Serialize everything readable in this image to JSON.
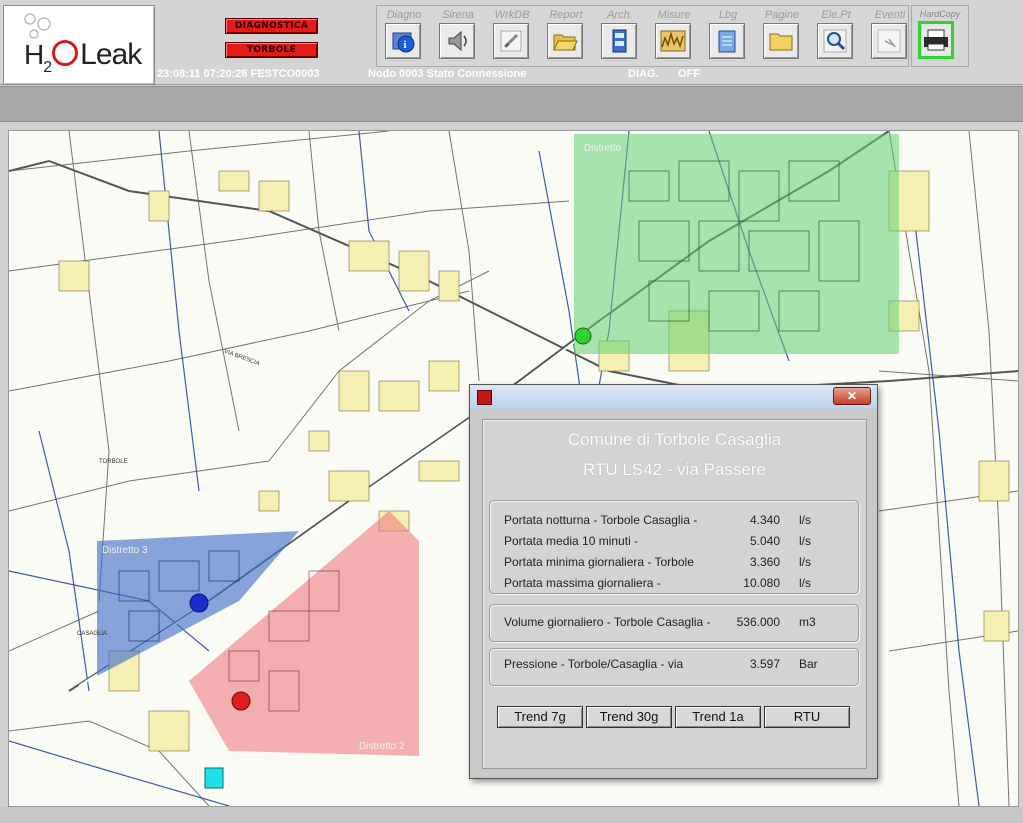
{
  "logo": {
    "h": "H",
    "sub": "2",
    "leak": "Leak"
  },
  "alarms": {
    "diagnostica": "DIAGNOSTICA",
    "torbole": "TORBOLE"
  },
  "toolbar": [
    {
      "label": "Diagno",
      "icon": "info-icon"
    },
    {
      "label": "Sirena",
      "icon": "speaker-icon"
    },
    {
      "label": "WrkDB",
      "icon": "edit-icon"
    },
    {
      "label": "Report",
      "icon": "folder-open-icon"
    },
    {
      "label": "Arch.",
      "icon": "cabinet-icon"
    },
    {
      "label": "Misure",
      "icon": "chart-icon"
    },
    {
      "label": "Lbg",
      "icon": "notepad-icon"
    },
    {
      "label": "Pagine",
      "icon": "folder-icon"
    },
    {
      "label": "Ele.Pt",
      "icon": "magnifier-icon"
    },
    {
      "label": "Eventi",
      "icon": "events-icon"
    }
  ],
  "hardcopy": {
    "label": "HardCopy",
    "icon": "printer-icon"
  },
  "status": {
    "time": "23:08:11 07:20:26 FESTCO0003",
    "node": "Nodo 0003 Stato Connessione",
    "diag": "DIAG.",
    "off": "OFF"
  },
  "map": {
    "zones": [
      {
        "label": "Distretto",
        "color": "#66cc7a"
      },
      {
        "label": "Distretto 3",
        "color": "#3d6fc9"
      },
      {
        "label": "Distretto 2",
        "color": "#ef7f86"
      }
    ],
    "labels": {
      "torbole": "TORBOLE",
      "casaglia": "CASAGLIA",
      "street": "VIA BRESCIA"
    },
    "markers": [
      {
        "name": "green-node",
        "color": "#2fd22f"
      },
      {
        "name": "blue-node",
        "color": "#1a2ed0"
      },
      {
        "name": "red-node",
        "color": "#e01c1c"
      },
      {
        "name": "cyan-node",
        "color": "#1fe0e8"
      }
    ]
  },
  "dialog": {
    "close": "✕",
    "title1": "Comune di Torbole Casaglia",
    "title2": "RTU LS42  - via Passere",
    "flows": [
      {
        "label": "Portata  notturna - Torbole Casaglia -",
        "value": "4.340",
        "unit": "l/s"
      },
      {
        "label": "Portata media 10 minuti -",
        "value": "5.040",
        "unit": "l/s"
      },
      {
        "label": "Portata  minima giornaliera - Torbole",
        "value": "3.360",
        "unit": "l/s"
      },
      {
        "label": "Portata  massima giornaliera -",
        "value": "10.080",
        "unit": "l/s"
      }
    ],
    "volume": {
      "label": "Volume giornaliero - Torbole Casaglia -",
      "value": "536.000",
      "unit": "m3"
    },
    "pressure": {
      "label": "Pressione - Torbole/Casaglia - via",
      "value": "3.597",
      "unit": "Bar"
    },
    "buttons": [
      "Trend 7g",
      "Trend 30g",
      "Trend 1a",
      "RTU"
    ]
  }
}
